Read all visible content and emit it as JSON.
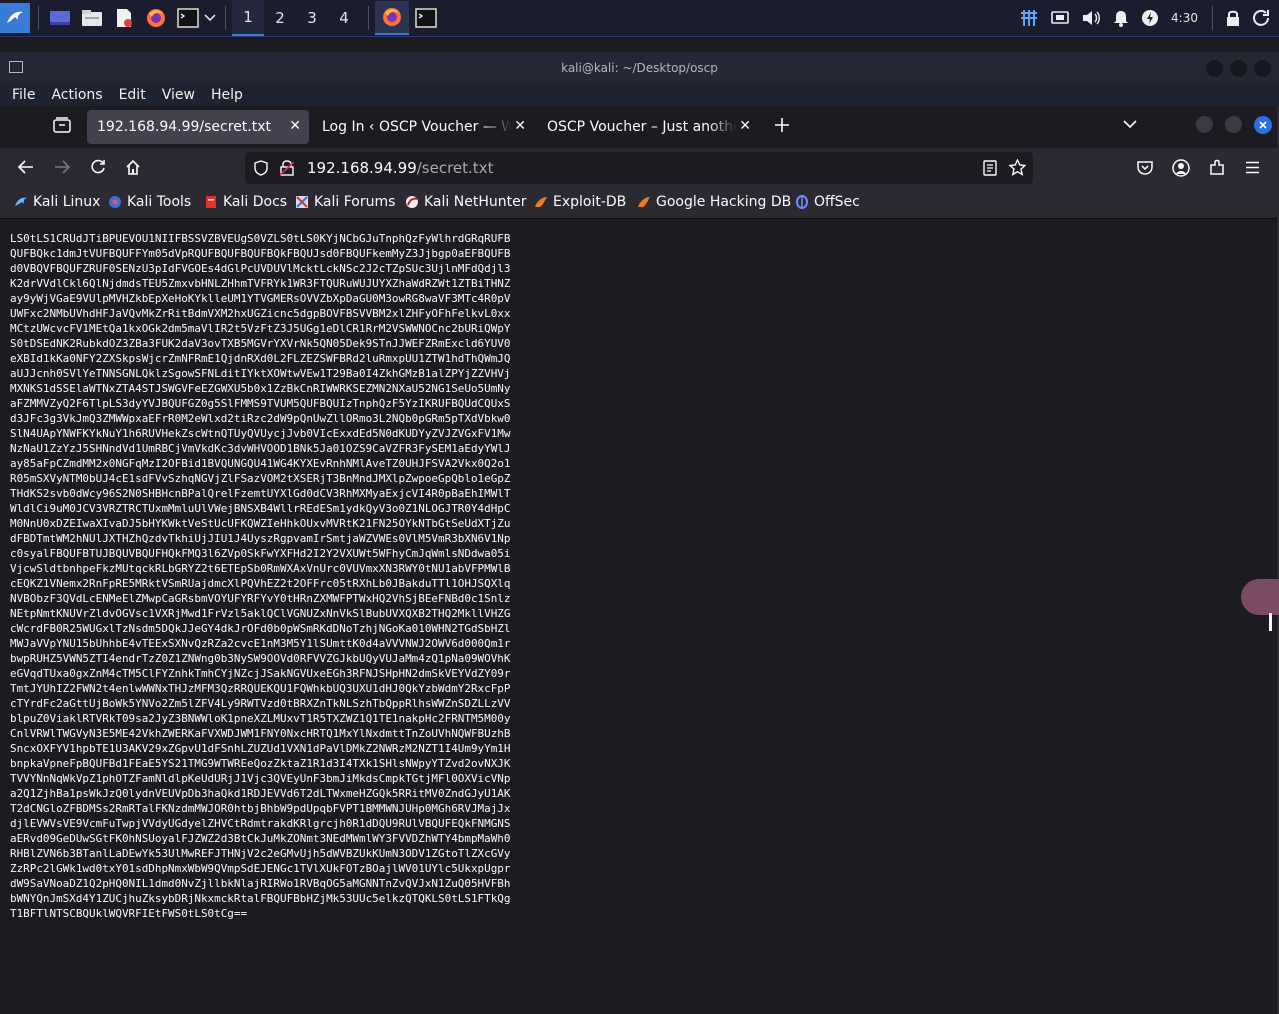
{
  "panel": {
    "workspaces": [
      "1",
      "2",
      "3",
      "4"
    ],
    "clock": "4:30"
  },
  "terminal": {
    "title": "kali@kali: ~/Desktop/oscp",
    "menu": [
      "File",
      "Actions",
      "Edit",
      "View",
      "Help"
    ]
  },
  "browser": {
    "tabs": [
      {
        "label": "192.168.94.99/secret.txt"
      },
      {
        "label": "Log In ‹ OSCP Voucher — Wo"
      },
      {
        "label": "OSCP Voucher – Just another"
      }
    ],
    "url": {
      "host": "192.168.94.99",
      "path": "/secret.txt"
    },
    "bookmarks": [
      "Kali Linux",
      "Kali Tools",
      "Kali Docs",
      "Kali Forums",
      "Kali NetHunter",
      "Exploit-DB",
      "Google Hacking DB",
      "OffSec"
    ]
  },
  "file_content": "LS0tLS1CRUdJTiBPUEVOU1NIIFBSSVZBVEUgS0VZLS0tLS0KYjNCbGJuTnphQzFyWlhrdGRqRUFB\nQUFBQkc1dmJtVUFBQUFFYm05dVpRQUFBQUFBQUFBQkFBQUJsd0FBQUFkemMyZ3Jjbgp0aEFBQUFB\nd0VBQVFBQUFZRUF0SENzU3pIdFVGOEs4dGlPcUVDUVlMcktLckNSc2J2cTZpSUc3UjlnMFdQdjl3\nK2drVVdlCkl6QlNjdmdsTEU5ZmxvbHNLZHhmTVFRYk1WR3FTQURuWUJUYXZhaWdRZWt1ZTBiTHNZ\nay9yWjVGaE9VUlpMVHZkbEpXeHoKYklleUM1YTVGMERsOVVZbXpDaGU0M3owRG8waVF3MTc4R0pV\nUWFxc2NMbUVhdHFJaVQvMkZrRitBdmVXM2hxUGZicnc5dgpBOVFBSVVBM2xlZHFyOFhFelkvL0xx\nMCtzUWcvcFV1MEtQa1kxOGk2dm5maVlIR2t5VzFtZ3J5UGg1eDlCR1RrM2VSWWNOCnc2bURiQWpY\nS0tDSEdNK2RubkdOZ3ZBa3FUK2daV3ovTXB5MGVrYXVrNk5QN05Dek9STnJJWEFZRmExcld6YUV0\neXBId1kKa0NFY2ZXSkpsWjcrZmNFRmE1QjdnRXd0L2FLZEZSWFBRd2luRmxpUU1ZTW1hdThQWmJQ\naUJJcnh0SVlYeTNNSGNLQklzSgowSFNLditIYktXOWtwVEw1T29Ba0I4ZkhGMzB1alZPYjZZVHVj\nMXNKS1dSSElaWTNxZTA4STJSWGVFeEZGWXU5b0x1ZzBkCnRIWWRKSEZMN2NXaU52NG1SeUo5UmNy\naFZMMVZyQ2F6TlpLS3dyYVJBQUFGZ0g5SlFMMS9TVUM5QUFBQUIzTnphQzF5YzIKRUFBQUdCQUxS\nd3JFc3g3VkJmQ3ZMWWpxaEFrR0M2eWlxd2tiRzc2dW9pQnUwZllORmo3L2NQb0pGRm5pTXdVbkw0\nSlN4UApYNWFKYkNuY1h6RUVHekZscWtnQTUyQVUycjJvb0VIcExxdEd5N0dKUDYyZVJZVGxFV1Mw\nNzNaU1ZzYzJ5SHNndVd1UmRBCjVmVkdKc3dvWHVOOD1BNk5Ja01OZS9CaVZFR3FySEM1aEdyYWlJ\nay85aFpCZmdMM2x0NGFqMzI2OFBid1BVQUNGQU41WG4KYXEvRnhNMlAveTZ0UHJFSVA2Vkx0Q2o1\nR05mSXVyNTM0bUJ4cE1sdFVvSzhqNGVjZlFSazVOM2tXSERjT3BnMndJMXlpZwpoeGpQblo1eGpZ\nTHdKS2svb0dWcy96S2N0SHBHcnBPalQrelFzemtUYXlGd0dCV3RhMXMyaExjcVI4R0pBaEhIMWlT\nWldlCi9uM0JCV3VRZTRCTUxmMmluUlVWejBNSXB4WllrREdESm1ydkQyV3o0Z1NLOGJTR0Y4dHpC\nM0NnU0xDZEIwaXIvaDJ5bHYKWktVeStUcUFKQWZIeHhkOUxvMVRtK21FN25OYkNTbGtSeUdXTjZu\ndFBDTmtWM2hNUlJXTHZhQzdvTkhiUjJIU1J4UyszRgpvamIrSmtjaWZVWEs0VlM5VmR3bXN6V1Np\nc0syalFBQUFBTUJBQUVBQUFHQkFMQ3l6ZVp0SkFwYXFHd2I2Y2VXUWt5WFhyCmJqWmlsNDdwa05i\nVjcwSldtbnhpeFkzMUtqckRLbGRYZ2t6ETEpSb0RmWXAxVnUrc0VUVmxXN3RWY0tNU1abVFPMWlB\ncEQKZ1VNemx2RnFpRE5MRktVSmRUajdmcXlPQVhEZ2t2OFFrc05tRXhLb0JBakduTTl1OHJSQXlq\nNVBObzF3QVdLcENMeElZMwpCaGRsbmVOYUFYRFYvY0tHRnZXMWFPTWxHQ2VhSjBEeFNBd0c1Snlz\nNEtpNmtKNUVrZldvOGVsc1VXRjMwd1FrVzl5aklQClVGNUZxNnVkSlBubUVXQXB2THQ2MkllVHZG\ncWcrdFB0R25WUGxlTzNsdm5DQkJJeGY4dkJrOFd0b0pWSmRKdDNoTzhjNGoKa010WHN2TGdSbHZl\nMWJaVVpYNU15bUhhbE4vTEExSXNvQzRZa2cvcE1nM3M5Y1lSUmttK0d4aVVVNWJ2OWV6d000Qm1r\nbwpRUHZ5VWN5ZTI4endrTzZ0Z1ZNWng0b3NySW9OOVd0RFVVZGJkbUQyVUJaMm4zQ1pNa09WOVhK\neGVqdTUxa0gxZnM4cTM5ClFYZnhkTmhCYjNZcjJSakNGVUxeEGh3RFNJSHpHN2dmSkVEYVdZY09r\nTmtJYUhIZ2FWN2t4enlwWWNxTHJzMFM3QzRRQUEKQU1FQWhkbUQ3UXU1dHJ0QkYzbWdmY2RxcFpP\ncTYrdFc2aGttUjBoWk5YNVo2Zm5lZFV4Ly9RWTVzd0tBRXZnTkNLSzhTbQppRlhsWWZnSDZLLzVV\nblpuZ0ViaklRTVRkT09sa2JyZ3BNWWloK1pneXZLMUxvT1R5TXZWZ1Q1TE1nakpHc2FRNTM5M00y\nCnlVRWlTWGVyN3E5ME42VkhZWERKaFVXWDJWM1FNY0NxcHRTQ1MxYlNxdmttTnZoUVhNQWFBUzhB\nSncxOXFYV1hpbTE1U3AKV29xZGpvU1dFSnhLZUZUd1VXN1dPaVlDMkZ2NWRzM2NZT1I4Um9yYm1H\nbnpkaVpneFpBQUFBd1FEaE5YS21TMG9WTWREeQozZktaZ1R1d3I4TXk1SHlsNWpyYTZvd2ovNXJK\nTVVYNnNqWkVpZ1phOTZFamNldlpKeUdURjJ1Vjc3QVEyUnF3bmJiMkdsCmpkTGtjMFl0OXVicVNp\na2Q1ZjhBa1psWkJzQ0lydnVEUVpDb3haQkd1RDJEVVd6T2dLTWxmeHZGQk5RRitMV0ZndGJyU1AK\nT2dCNGloZFBDMSs2RmRTalFKNzdmMWJOR0htbjBhbW9pdUpqbFVPT1BMMWNJUHp0MGh6RVJMajJx\ndjlEVWVsVE9VcmFuTwpjVVdyUGdyelZHVCtRdmtrakdKRlgrcjh0R1dDQU9RUlVBQUFEQkFNMGNS\naERvd09GeDUwSGtFK0hNSUoyalFJZWZ2d3BtCkJuMkZONmt3NEdMWmlWY3FVVDZhWTY4bmpMaWh0\nRHBlZVN6b3BTanlLaDEwYk53UlMwREFJTHNjV2c2eGMvUjh5dWVBZUkKUmN3ODV1ZGtoTlZXcGVy\nZzRPc2lGWk1wd0txY01sdDhpNmxWbW9QVmpSdEJENGc1TVlXUkFOTzBOajlWV01UYlc5UkxpUgpr\ndW9SaVNoaDZ1Q2pHQ0NIL1dmd0NvZjllbkNlajRIRWo1RVBqOG5aMGNNTnZvQVJxN1ZuQ05HVFBh\nbWNYQnJmSXd4Y1ZUCjhuZksybDRjNkxmckRtalFBQUFBbHZjMk53UUc5elkzQTQKLS0tLS1FTkQg\nT1BFTlNTSCBQUklWQVRFIEtFWS0tLS0tCg=="
}
